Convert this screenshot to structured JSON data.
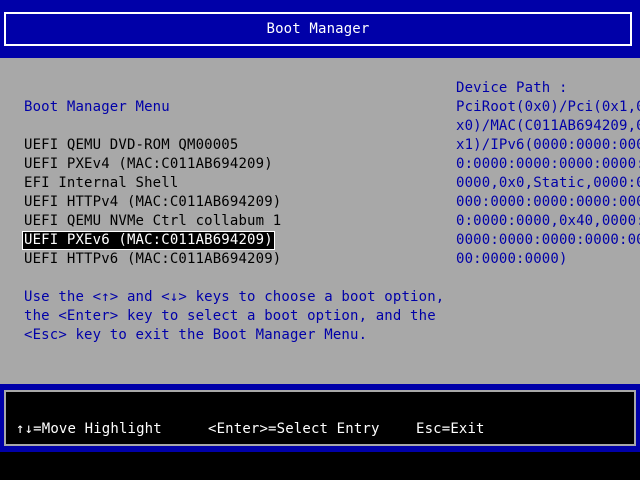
{
  "header": {
    "title": "Boot Manager"
  },
  "menu": {
    "title": "Boot Manager Menu",
    "items": [
      {
        "label": "UEFI QEMU DVD-ROM QM00005",
        "selected": false
      },
      {
        "label": "UEFI PXEv4 (MAC:C011AB694209)",
        "selected": false
      },
      {
        "label": "EFI Internal Shell",
        "selected": false
      },
      {
        "label": "UEFI HTTPv4 (MAC:C011AB694209)",
        "selected": false
      },
      {
        "label": "UEFI QEMU NVMe Ctrl collabum 1",
        "selected": false
      },
      {
        "label": "UEFI PXEv6 (MAC:C011AB694209)",
        "selected": true
      },
      {
        "label": "UEFI HTTPv6 (MAC:C011AB694209)",
        "selected": false
      }
    ],
    "help_lines": [
      "Use the <↑> and <↓> keys to choose a boot option,",
      "the <Enter> key to select a boot option, and the",
      "<Esc> key to exit the Boot Manager Menu."
    ]
  },
  "device_path": {
    "heading": "Device Path :",
    "lines": [
      "PciRoot(0x0)/Pci(0x1,0",
      "x0)/MAC(C011AB694209,0",
      "x1)/IPv6(0000:0000:000",
      "0:0000:0000:0000:0000:",
      "0000,0x0,Static,0000:0",
      "000:0000:0000:0000:000",
      "0:0000:0000,0x40,0000:",
      "0000:0000:0000:0000:00",
      "00:0000:0000)"
    ]
  },
  "footer": {
    "move": "↑↓=Move Highlight",
    "select": "<Enter>=Select Entry",
    "exit": "Esc=Exit"
  },
  "colors": {
    "bios_blue": "#0000a8",
    "bios_grey": "#a8a8a8",
    "text_white": "#ffffff",
    "text_black": "#000000"
  }
}
